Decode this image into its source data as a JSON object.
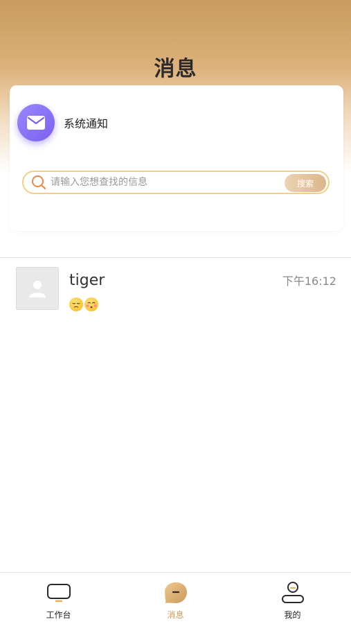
{
  "header": {
    "title": "消息"
  },
  "system_notice": {
    "label": "系统通知",
    "icon": "envelope-icon"
  },
  "search": {
    "placeholder": "请输入您想查找的信息",
    "value": "",
    "button_label": "搜索"
  },
  "conversations": [
    {
      "name": "tiger",
      "time": "下午16:12",
      "last_message": "😔😚",
      "avatar": "default-user-avatar"
    }
  ],
  "tabbar": {
    "items": [
      {
        "label": "工作台",
        "icon": "monitor-icon",
        "active": false
      },
      {
        "label": "消息",
        "icon": "chat-bubble-icon",
        "active": true
      },
      {
        "label": "我的",
        "icon": "user-icon",
        "active": false
      }
    ]
  },
  "colors": {
    "accent": "#c9985a",
    "notice_icon": "#7b5ff0",
    "search_border": "#f3cf86"
  }
}
